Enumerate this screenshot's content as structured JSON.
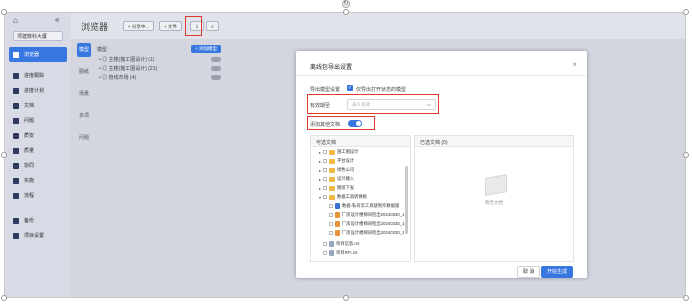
{
  "sidebar": {
    "logo": "⌂",
    "collapse": "«",
    "project": "项建数科大厦",
    "items": [
      {
        "label": "浏览器",
        "icon": "browser-icon",
        "active": true
      },
      {
        "label": "进度跟踪",
        "icon": "progress-icon",
        "active": false
      },
      {
        "label": "进度计划",
        "icon": "plan-icon",
        "active": false
      },
      {
        "label": "文档",
        "icon": "doc-icon",
        "active": false
      },
      {
        "label": "问题",
        "icon": "issue-icon",
        "active": false
      },
      {
        "label": "质安",
        "icon": "quality-icon",
        "active": false
      },
      {
        "label": "质量",
        "icon": "quality2-icon",
        "active": false
      },
      {
        "label": "协同",
        "icon": "collab-icon",
        "active": false
      },
      {
        "label": "实施",
        "icon": "implement-icon",
        "active": false
      },
      {
        "label": "流程",
        "icon": "flow-icon",
        "active": false
      },
      {
        "label": "备份",
        "icon": "backup-icon",
        "active": false
      },
      {
        "label": "项目设置",
        "icon": "settings-icon",
        "active": false
      }
    ]
  },
  "topbar": {
    "title": "浏览器",
    "share_label": "< 分享中...",
    "add_label": "+ 文件",
    "export_label": "⇩",
    "more_label": "≡"
  },
  "left_tabs": [
    "模型",
    "图纸",
    "场景",
    "多项",
    "问题"
  ],
  "folder_pane": {
    "header": "模型",
    "add_label": "+ 添加模型",
    "rows": [
      "• ◎ 主楼(施工图设计) (1)",
      "• ◎ 主楼(施工图设计) (21)",
      "• ◎ 管线市场 (4)"
    ]
  },
  "dialog": {
    "title": "离线包导出设置",
    "close": "×",
    "model_setting_label": "导出模型设置",
    "model_only_open": "仅导出打开状态的模型",
    "validity_label": "有效期至",
    "validity_placeholder": "永久有效",
    "attach_docs_label": "添加其他文档",
    "left_panel_title": "可选文档",
    "right_panel_title": "已选文档 (0)",
    "empty_text": "暂无文档",
    "tree": [
      {
        "label": "施工图设计",
        "type": "folder",
        "depth": 1
      },
      {
        "label": "平台设计",
        "type": "folder",
        "depth": 1
      },
      {
        "label": "绿色公司",
        "type": "folder",
        "depth": 1
      },
      {
        "label": "设计输入",
        "type": "folder",
        "depth": 1
      },
      {
        "label": "图纸下发",
        "type": "folder",
        "depth": 1
      },
      {
        "label": "数据工具转换板",
        "type": "folder",
        "depth": 1
      },
      {
        "label": "数据-私有云工具链制作数据版",
        "type": "doc-blue",
        "depth": 2
      },
      {
        "label": "厂房设计楼梯间检出20240330_1",
        "type": "doc-orange",
        "depth": 2
      },
      {
        "label": "厂房设计楼梯间检出20240330_1",
        "type": "doc-orange",
        "depth": 2
      },
      {
        "label": "厂房设计楼梯间检出20240330_1",
        "type": "doc-orange",
        "depth": 2
      },
      {
        "label": "项目信息.rvt",
        "type": "doc-gray",
        "depth": 1
      },
      {
        "label": "项目RFI.rvt",
        "type": "doc-gray",
        "depth": 1
      }
    ],
    "cancel_label": "取 消",
    "confirm_label": "开始生成"
  },
  "colors": {
    "accent": "#3876e0",
    "highlight": "#e03b2e",
    "overlay": "#8a8a92"
  }
}
